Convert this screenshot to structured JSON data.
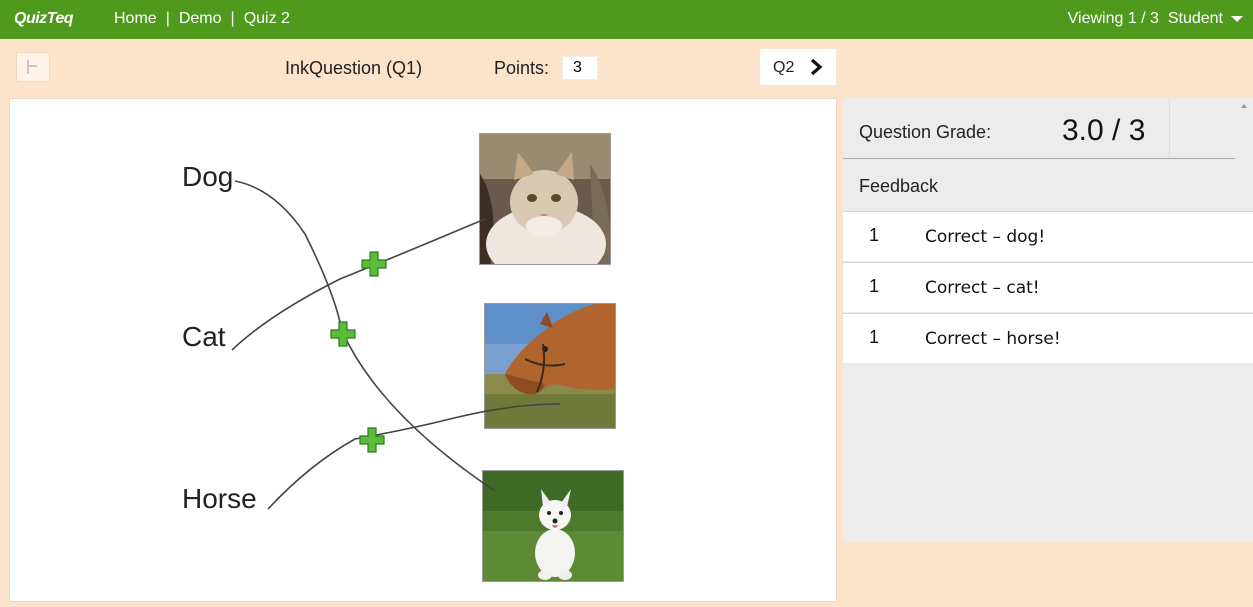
{
  "topbar": {
    "brand": "QuizTeq",
    "nav": [
      {
        "label": "Home"
      },
      {
        "label": "Demo"
      },
      {
        "label": "Quiz 2"
      }
    ],
    "separator": "|",
    "viewing": "Viewing 1 / 3",
    "user": "Student"
  },
  "toolbar": {
    "question_title": "InkQuestion (Q1)",
    "points_label": "Points:",
    "points_value": "3",
    "next_label": "Q2"
  },
  "question": {
    "words": [
      "Dog",
      "Cat",
      "Horse"
    ],
    "images": [
      "cat-photo",
      "horse-photo",
      "dog-photo"
    ],
    "ink_color": "#444444",
    "correct_mark_color": "#5dbb3a"
  },
  "grade": {
    "label": "Question Grade:",
    "value": "3.0 / 3"
  },
  "feedback": {
    "title": "Feedback",
    "items": [
      {
        "points": "1",
        "text": "Correct – dog!"
      },
      {
        "points": "1",
        "text": "Correct – cat!"
      },
      {
        "points": "1",
        "text": "Correct – horse!"
      }
    ]
  },
  "colors": {
    "topbar": "#4f9a1d",
    "background": "#fbe3cc",
    "panel": "#ececec"
  }
}
